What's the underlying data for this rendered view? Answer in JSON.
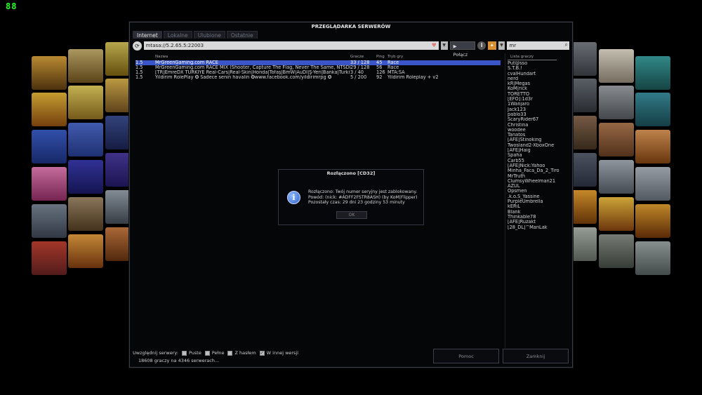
{
  "overlay": {
    "fps": "88"
  },
  "window": {
    "title": "PRZEGLĄDARKA SERWERÓW",
    "tabs": [
      "Internet",
      "Lokalne",
      "Ulubione",
      "Ostatnie"
    ],
    "address_value": "mtasa://5.2.65.5:22003",
    "connect_label": "▶ Połącz",
    "search_value": "mr"
  },
  "columns": {
    "name": "Nazwa",
    "players": "Gracze",
    "ping": "Ping",
    "mode": "Tryb gry"
  },
  "servers": [
    {
      "version": "1.5",
      "name": "MrGreenGaming.com RACE",
      "players": "33 / 128",
      "ping": "45",
      "mode": "Race"
    },
    {
      "version": "1.5",
      "name": "MrGreenGaming.com RACE MIX (Shooter, Capture The Flag, Never The Same, NTSDD, RTF)",
      "players": "29 / 128",
      "ping": "56",
      "mode": "Race"
    },
    {
      "version": "1.5",
      "name": "[TR]EmreDX TURKIYE Real-Cars|Real-Skin|Honda|Tofaş|BmW|AuDİ|Ş-Yeri|Banka|Turkiye",
      "players": "3 / 40",
      "ping": "126",
      "mode": "MTA:SA"
    },
    {
      "version": "1.5",
      "name": "Yildirim RolePlay ✪ Sadece senin havalin ✪www.facebook.com/yildirimrpg ✪",
      "players": "5 / 200",
      "ping": "92",
      "mode": "Yildirim Roleplay + v2"
    }
  ],
  "player_list": {
    "header": "Lista graczy",
    "players": [
      "Put@sso",
      "S.T.B.!",
      "cvalHundart",
      "nerd",
      "kR|Megas",
      "KoM|rick",
      "TORETTO",
      "[EFO]:1d3r",
      "1Wanjaro",
      "Jack123",
      "pablo33",
      "ScaryRider67",
      "Christina",
      "woodee",
      "Tanatos",
      "[AFE]Stinoking",
      "Twosland2-XboxOne",
      "[AFE]Haig",
      "Spaha",
      "Carb55",
      "[AFE]Nick:Yahoo",
      "Minha_Faca_Da_2_Tiro",
      "MrTruth",
      "ClumsyWheelman21",
      "AZUL",
      "Opsmen",
      ".k.o.S_Yassine",
      "PurpleUmbrella",
      "kERiL",
      "Blank",
      "Thinkable78",
      "[AFE]Ruzakt",
      "[28_DL]^ManLak"
    ]
  },
  "dialog": {
    "title": "Rozłączono [CD32]",
    "lines": [
      "Rozłączono: Twój numer seryjny jest zablokowany.",
      "Powód: (nick: #ADFF2FSTR8ASH) (by KoM|Flipper)",
      "Pozostały czas: 29 dni 23 godziny 53 minuty"
    ],
    "ok_label": "OK"
  },
  "bottom": {
    "filters_label": "Uwzględnij serwery:",
    "filters": [
      "Puste",
      "Pełne",
      "Z hasłem",
      "W innej wersji"
    ],
    "status": "18608 graczy na 4346 serwerach...",
    "help_label": "Pomoc",
    "close_label": "Zamknij"
  },
  "colors": {
    "selection": "#3a55c8",
    "fps": "#22ff22"
  }
}
